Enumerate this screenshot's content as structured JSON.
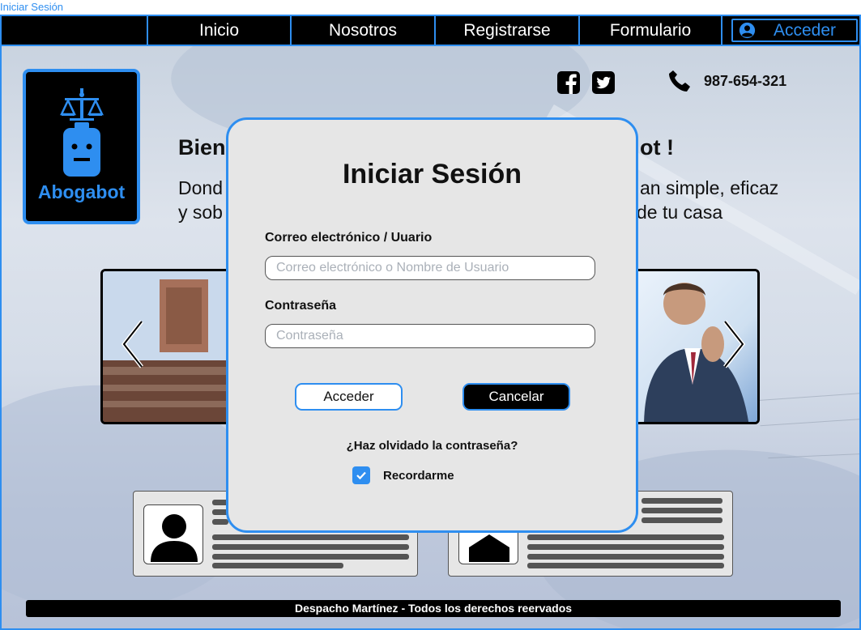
{
  "window": {
    "title": "Iniciar Sesión"
  },
  "nav": {
    "items": [
      {
        "label": "Inicio"
      },
      {
        "label": "Nosotros"
      },
      {
        "label": "Registrarse"
      },
      {
        "label": "Formulario"
      }
    ],
    "login_label": "Acceder",
    "login_icon": "user-circle-icon"
  },
  "brand": {
    "name": "Abogabot",
    "icon": "robot-scales-icon"
  },
  "social": {
    "icons": [
      "facebook-icon",
      "twitter-icon"
    ]
  },
  "contact": {
    "phone_icon": "phone-icon",
    "phone": "987-654-321"
  },
  "hero": {
    "title_left": "Bien",
    "title_right": "ot !",
    "sub_line1_left": "Dond",
    "sub_line1_right": "an simple, eficaz",
    "sub_line2_left": "y sob",
    "sub_line2_right": "de tu casa"
  },
  "carousel": {
    "prev_icon": "chevron-left-icon",
    "next_icon": "chevron-right-icon"
  },
  "footer": {
    "text": "Despacho Martínez   -  Todos los derechos reervados"
  },
  "modal": {
    "title": "Iniciar Sesión",
    "email_label": "Correo electrónico / Uuario",
    "email_placeholder": "Correo electrónico o Nombre de Usuario",
    "email_value": "",
    "password_label": "Contraseña",
    "password_placeholder": "Contraseña",
    "password_value": "",
    "submit_label": "Acceder",
    "cancel_label": "Cancelar",
    "forgot_label": "¿Haz olvidado la contraseña?",
    "remember_label": "Recordarme",
    "remember_checked": true
  },
  "colors": {
    "accent": "#2e8ef0",
    "dark": "#000000",
    "modal_bg": "#e6e6e6"
  }
}
